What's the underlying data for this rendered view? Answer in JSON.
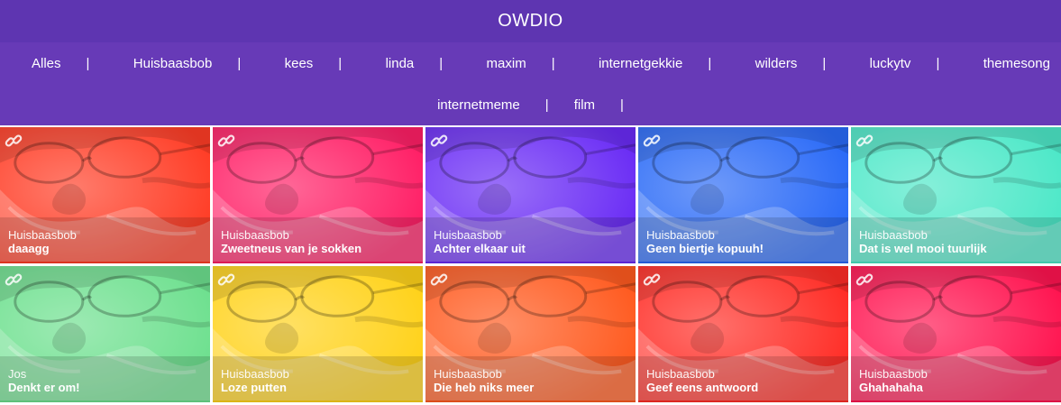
{
  "header": {
    "title": "OWDIO"
  },
  "nav": {
    "row1": [
      "Alles",
      "Huisbaasbob",
      "kees",
      "linda",
      "maxim",
      "internetgekkie",
      "wilders",
      "luckytv",
      "themesong"
    ],
    "row2": [
      "internetmeme",
      "film"
    ],
    "separator": "|"
  },
  "tiles": [
    {
      "author": "Huisbaasbob",
      "title": "daaagg",
      "color": "#ff3d26",
      "icon": "link-icon"
    },
    {
      "author": "Huisbaasbob",
      "title": "Zweetneus van je sokken",
      "color": "#ff1f66",
      "icon": "link-icon"
    },
    {
      "author": "Huisbaasbob",
      "title": "Achter elkaar uit",
      "color": "#6a2cf5",
      "icon": "link-icon"
    },
    {
      "author": "Huisbaasbob",
      "title": "Geen biertje kopuuh!",
      "color": "#2a6af7",
      "icon": "link-icon"
    },
    {
      "author": "Huisbaasbob",
      "title": "Dat is wel mooi tuurlijk",
      "color": "#4de8c8",
      "icon": "link-icon"
    },
    {
      "author": "Jos",
      "title": "Denkt er om!",
      "color": "#6ee08f",
      "icon": "link-icon"
    },
    {
      "author": "Huisbaasbob",
      "title": "Loze putten",
      "color": "#ffd21a",
      "icon": "link-icon"
    },
    {
      "author": "Huisbaasbob",
      "title": "Die heb niks meer",
      "color": "#ff5a1f",
      "icon": "link-icon"
    },
    {
      "author": "Huisbaasbob",
      "title": "Geef eens antwoord",
      "color": "#ff2d26",
      "icon": "link-icon"
    },
    {
      "author": "Huisbaasbob",
      "title": "Ghahahaha",
      "color": "#ff1450",
      "icon": "link-icon"
    }
  ]
}
